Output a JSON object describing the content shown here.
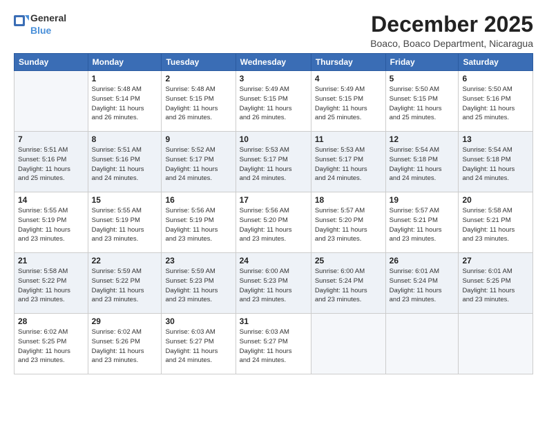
{
  "header": {
    "logo_general": "General",
    "logo_blue": "Blue",
    "month_year": "December 2025",
    "location": "Boaco, Boaco Department, Nicaragua"
  },
  "weekdays": [
    "Sunday",
    "Monday",
    "Tuesday",
    "Wednesday",
    "Thursday",
    "Friday",
    "Saturday"
  ],
  "weeks": [
    [
      {
        "day": "",
        "info": ""
      },
      {
        "day": "1",
        "info": "Sunrise: 5:48 AM\nSunset: 5:14 PM\nDaylight: 11 hours\nand 26 minutes."
      },
      {
        "day": "2",
        "info": "Sunrise: 5:48 AM\nSunset: 5:15 PM\nDaylight: 11 hours\nand 26 minutes."
      },
      {
        "day": "3",
        "info": "Sunrise: 5:49 AM\nSunset: 5:15 PM\nDaylight: 11 hours\nand 26 minutes."
      },
      {
        "day": "4",
        "info": "Sunrise: 5:49 AM\nSunset: 5:15 PM\nDaylight: 11 hours\nand 25 minutes."
      },
      {
        "day": "5",
        "info": "Sunrise: 5:50 AM\nSunset: 5:15 PM\nDaylight: 11 hours\nand 25 minutes."
      },
      {
        "day": "6",
        "info": "Sunrise: 5:50 AM\nSunset: 5:16 PM\nDaylight: 11 hours\nand 25 minutes."
      }
    ],
    [
      {
        "day": "7",
        "info": "Sunrise: 5:51 AM\nSunset: 5:16 PM\nDaylight: 11 hours\nand 25 minutes."
      },
      {
        "day": "8",
        "info": "Sunrise: 5:51 AM\nSunset: 5:16 PM\nDaylight: 11 hours\nand 24 minutes."
      },
      {
        "day": "9",
        "info": "Sunrise: 5:52 AM\nSunset: 5:17 PM\nDaylight: 11 hours\nand 24 minutes."
      },
      {
        "day": "10",
        "info": "Sunrise: 5:53 AM\nSunset: 5:17 PM\nDaylight: 11 hours\nand 24 minutes."
      },
      {
        "day": "11",
        "info": "Sunrise: 5:53 AM\nSunset: 5:17 PM\nDaylight: 11 hours\nand 24 minutes."
      },
      {
        "day": "12",
        "info": "Sunrise: 5:54 AM\nSunset: 5:18 PM\nDaylight: 11 hours\nand 24 minutes."
      },
      {
        "day": "13",
        "info": "Sunrise: 5:54 AM\nSunset: 5:18 PM\nDaylight: 11 hours\nand 24 minutes."
      }
    ],
    [
      {
        "day": "14",
        "info": "Sunrise: 5:55 AM\nSunset: 5:19 PM\nDaylight: 11 hours\nand 23 minutes."
      },
      {
        "day": "15",
        "info": "Sunrise: 5:55 AM\nSunset: 5:19 PM\nDaylight: 11 hours\nand 23 minutes."
      },
      {
        "day": "16",
        "info": "Sunrise: 5:56 AM\nSunset: 5:19 PM\nDaylight: 11 hours\nand 23 minutes."
      },
      {
        "day": "17",
        "info": "Sunrise: 5:56 AM\nSunset: 5:20 PM\nDaylight: 11 hours\nand 23 minutes."
      },
      {
        "day": "18",
        "info": "Sunrise: 5:57 AM\nSunset: 5:20 PM\nDaylight: 11 hours\nand 23 minutes."
      },
      {
        "day": "19",
        "info": "Sunrise: 5:57 AM\nSunset: 5:21 PM\nDaylight: 11 hours\nand 23 minutes."
      },
      {
        "day": "20",
        "info": "Sunrise: 5:58 AM\nSunset: 5:21 PM\nDaylight: 11 hours\nand 23 minutes."
      }
    ],
    [
      {
        "day": "21",
        "info": "Sunrise: 5:58 AM\nSunset: 5:22 PM\nDaylight: 11 hours\nand 23 minutes."
      },
      {
        "day": "22",
        "info": "Sunrise: 5:59 AM\nSunset: 5:22 PM\nDaylight: 11 hours\nand 23 minutes."
      },
      {
        "day": "23",
        "info": "Sunrise: 5:59 AM\nSunset: 5:23 PM\nDaylight: 11 hours\nand 23 minutes."
      },
      {
        "day": "24",
        "info": "Sunrise: 6:00 AM\nSunset: 5:23 PM\nDaylight: 11 hours\nand 23 minutes."
      },
      {
        "day": "25",
        "info": "Sunrise: 6:00 AM\nSunset: 5:24 PM\nDaylight: 11 hours\nand 23 minutes."
      },
      {
        "day": "26",
        "info": "Sunrise: 6:01 AM\nSunset: 5:24 PM\nDaylight: 11 hours\nand 23 minutes."
      },
      {
        "day": "27",
        "info": "Sunrise: 6:01 AM\nSunset: 5:25 PM\nDaylight: 11 hours\nand 23 minutes."
      }
    ],
    [
      {
        "day": "28",
        "info": "Sunrise: 6:02 AM\nSunset: 5:25 PM\nDaylight: 11 hours\nand 23 minutes."
      },
      {
        "day": "29",
        "info": "Sunrise: 6:02 AM\nSunset: 5:26 PM\nDaylight: 11 hours\nand 23 minutes."
      },
      {
        "day": "30",
        "info": "Sunrise: 6:03 AM\nSunset: 5:27 PM\nDaylight: 11 hours\nand 24 minutes."
      },
      {
        "day": "31",
        "info": "Sunrise: 6:03 AM\nSunset: 5:27 PM\nDaylight: 11 hours\nand 24 minutes."
      },
      {
        "day": "",
        "info": ""
      },
      {
        "day": "",
        "info": ""
      },
      {
        "day": "",
        "info": ""
      }
    ]
  ]
}
